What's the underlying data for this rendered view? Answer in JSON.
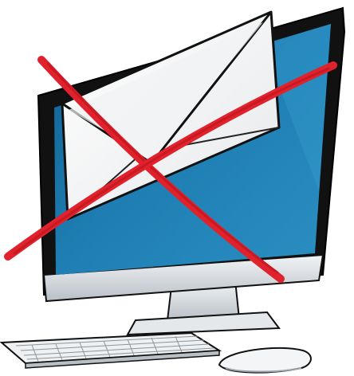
{
  "illustration": {
    "colors": {
      "screen_blue": "#1f7fb4",
      "monitor_black": "#111111",
      "monitor_silver": "#d8dde2",
      "envelope_white": "#f7f7f7",
      "cross_red": "#e0222c"
    },
    "icons": [
      "computer-monitor-icon",
      "envelope-icon",
      "keyboard-icon",
      "mouse-icon",
      "red-x-icon"
    ]
  }
}
